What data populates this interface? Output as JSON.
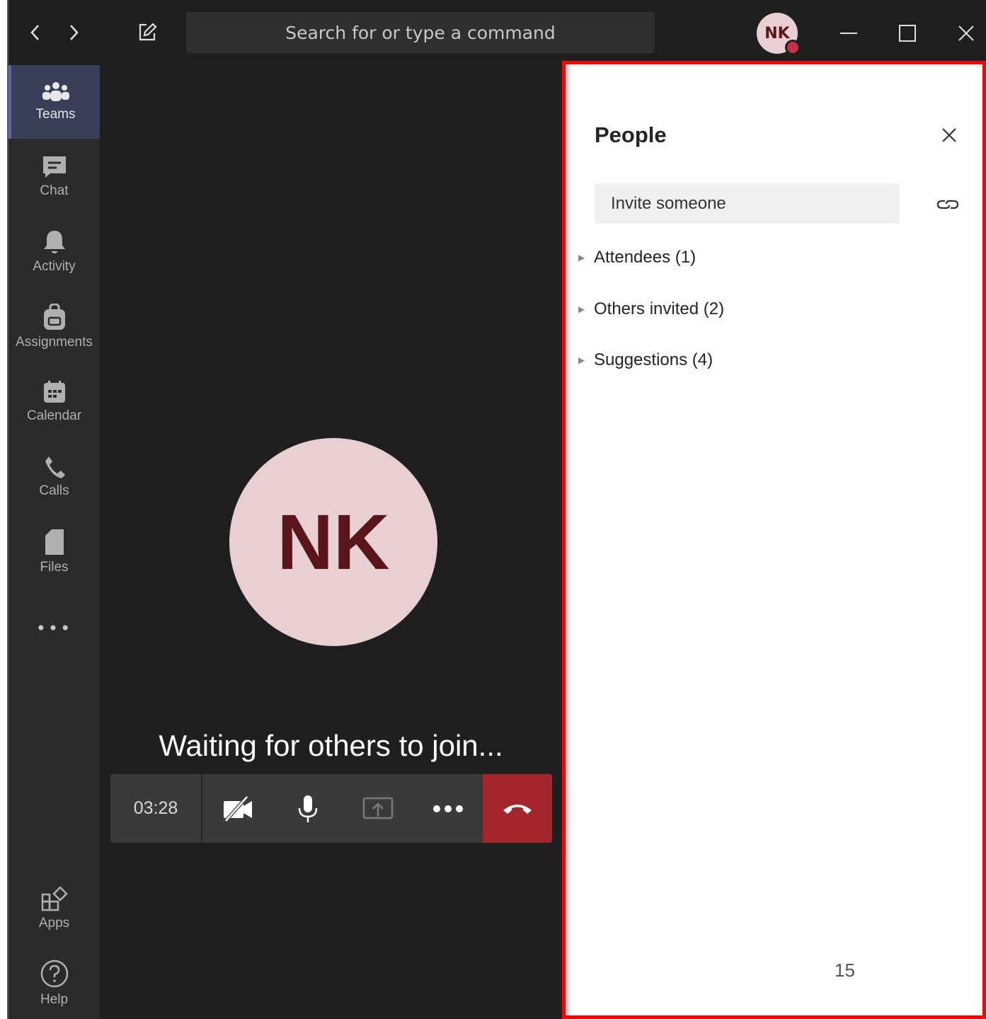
{
  "titlebar": {
    "search_placeholder": "Search for or type a command",
    "user_initials": "NK"
  },
  "rail": {
    "items": [
      {
        "label": "Teams",
        "icon": "teams-icon",
        "active": true
      },
      {
        "label": "Chat",
        "icon": "chat-icon"
      },
      {
        "label": "Activity",
        "icon": "bell-icon"
      },
      {
        "label": "Assignments",
        "icon": "backpack-icon"
      },
      {
        "label": "Calendar",
        "icon": "calendar-icon"
      },
      {
        "label": "Calls",
        "icon": "phone-icon"
      },
      {
        "label": "Files",
        "icon": "file-icon"
      }
    ],
    "more": "•••",
    "bottom": [
      {
        "label": "Apps",
        "icon": "apps-icon"
      },
      {
        "label": "Help",
        "icon": "help-icon"
      }
    ]
  },
  "stage": {
    "avatar_initials": "NK",
    "waiting_text": "Waiting for others to join...",
    "timer": "03:28"
  },
  "people": {
    "title": "People",
    "invite_placeholder": "Invite someone",
    "groups": [
      {
        "label": "Attendees",
        "count": "(1)"
      },
      {
        "label": "Others invited",
        "count": "(2)"
      },
      {
        "label": "Suggestions",
        "count": "(4)"
      }
    ],
    "page_number": "15"
  },
  "colors": {
    "accent": "#6264a7",
    "hangup": "#a4262c",
    "avatar_bg": "#e8cfd3",
    "avatar_text": "#5a151b",
    "highlight_frame": "#ff0000"
  }
}
